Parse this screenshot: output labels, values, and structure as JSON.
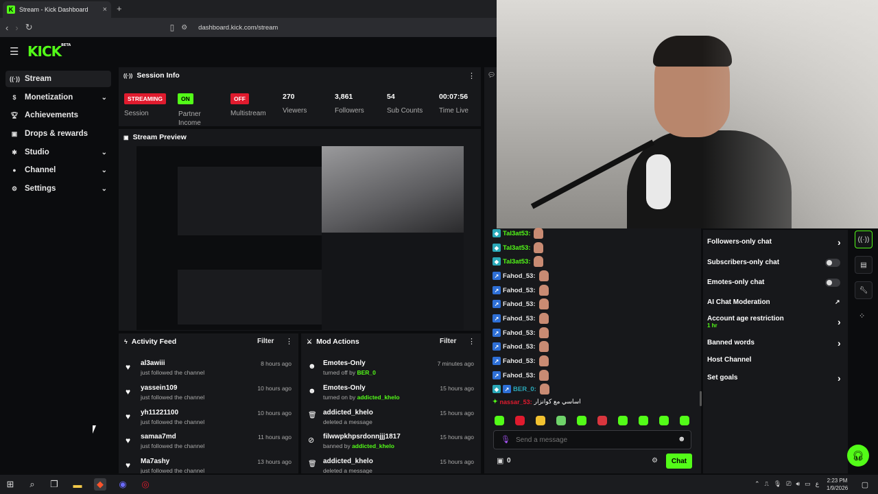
{
  "browser": {
    "tab_title": "Stream - Kick Dashboard",
    "tab_close": "×",
    "new_tab": "+",
    "url": "dashboard.kick.com/stream"
  },
  "app": {
    "logo": "KICK",
    "logo_beta": "BETA"
  },
  "sidebar": {
    "items": [
      {
        "label": "Stream",
        "icon": "broadcast-icon"
      },
      {
        "label": "Monetization",
        "icon": "dollar-icon"
      },
      {
        "label": "Achievements",
        "icon": "trophy-icon"
      },
      {
        "label": "Drops & rewards",
        "icon": "gift-icon"
      },
      {
        "label": "Studio",
        "icon": "studio-icon"
      },
      {
        "label": "Channel",
        "icon": "user-icon"
      },
      {
        "label": "Settings",
        "icon": "gear-icon"
      }
    ]
  },
  "session": {
    "title": "Session Info",
    "stats": [
      {
        "value": "STREAMING",
        "label": "Session"
      },
      {
        "value": "ON",
        "label": "Partner Income"
      },
      {
        "value": "OFF",
        "label": "Multistream"
      },
      {
        "value": "270",
        "label": "Viewers"
      },
      {
        "value": "3,861",
        "label": "Followers"
      },
      {
        "value": "54",
        "label": "Sub Counts"
      },
      {
        "value": "00:07:56",
        "label": "Time Live"
      }
    ]
  },
  "preview": {
    "title": "Stream Preview"
  },
  "activity": {
    "title": "Activity Feed",
    "filter": "Filter",
    "items": [
      {
        "name": "al3awiii",
        "desc": "just followed the channel",
        "time": "8 hours ago"
      },
      {
        "name": "yassein109",
        "desc": "just followed the channel",
        "time": "10 hours ago"
      },
      {
        "name": "yh11221100",
        "desc": "just followed the channel",
        "time": "10 hours ago"
      },
      {
        "name": "samaa7md",
        "desc": "just followed the channel",
        "time": "11 hours ago"
      },
      {
        "name": "Ma7ashy",
        "desc": "just followed the channel",
        "time": "13 hours ago"
      }
    ]
  },
  "mod": {
    "title": "Mod Actions",
    "filter": "Filter",
    "items": [
      {
        "name": "Emotes-Only",
        "desc": "turned off by",
        "user": "BER_0",
        "time": "7 minutes ago"
      },
      {
        "name": "Emotes-Only",
        "desc": "turned on by",
        "user": "addicted_khelo",
        "time": "15 hours ago"
      },
      {
        "name": "addicted_khelo",
        "desc": "deleted a message",
        "user": "",
        "time": "15 hours ago"
      },
      {
        "name": "filwwpkhpsrdonnjjj1817",
        "desc": "banned by",
        "user": "addicted_khelo",
        "time": "15 hours ago"
      },
      {
        "name": "addicted_khelo",
        "desc": "deleted a message",
        "user": "",
        "time": "15 hours ago"
      }
    ]
  },
  "chat": {
    "messages": [
      {
        "user": "Tal3at53:",
        "color": "#53fc18",
        "badge_color": "#2aa8b8"
      },
      {
        "user": "Tal3at53:",
        "color": "#53fc18",
        "badge_color": "#2aa8b8"
      },
      {
        "user": "Tal3at53:",
        "color": "#53fc18",
        "badge_color": "#2aa8b8"
      },
      {
        "user": "Fahod_53:",
        "color": "#ffffff",
        "badge_color": "#2e6fd6"
      },
      {
        "user": "Fahod_53:",
        "color": "#ffffff",
        "badge_color": "#2e6fd6"
      },
      {
        "user": "Fahod_53:",
        "color": "#ffffff",
        "badge_color": "#2e6fd6"
      },
      {
        "user": "Fahod_53:",
        "color": "#ffffff",
        "badge_color": "#2e6fd6"
      },
      {
        "user": "Fahod_53:",
        "color": "#ffffff",
        "badge_color": "#2e6fd6"
      },
      {
        "user": "Fahod_53:",
        "color": "#ffffff",
        "badge_color": "#2e6fd6"
      },
      {
        "user": "Fahod_53:",
        "color": "#ffffff",
        "badge_color": "#2e6fd6"
      },
      {
        "user": "Fahod_53:",
        "color": "#ffffff",
        "badge_color": "#2e6fd6"
      },
      {
        "user": "BER_0:",
        "color": "#2aa8b8",
        "badge_color": "#2aa8b8"
      }
    ],
    "last_user": "nassar_53:",
    "last_text": "اساسي مع كوانزار",
    "placeholder": "Send a message",
    "points": "0",
    "send": "Chat"
  },
  "chat_settings": {
    "items": [
      {
        "label": "Followers-only chat",
        "control": "chevron"
      },
      {
        "label": "Subscribers-only chat",
        "control": "toggle"
      },
      {
        "label": "Emotes-only chat",
        "control": "toggle"
      },
      {
        "label": "AI Chat Moderation",
        "control": "link"
      },
      {
        "label": "Account age restriction",
        "sub": "1 hr",
        "control": "chevron"
      },
      {
        "label": "Banned words",
        "control": "chevron"
      },
      {
        "label": "Host Channel",
        "control": "none"
      },
      {
        "label": "Set goals",
        "control": "chevron"
      }
    ]
  },
  "taskbar": {
    "time": "2:23 PM",
    "date": "1/9/2026",
    "lang": "ع"
  },
  "colors": {
    "accent": "#53fc18",
    "live_red": "#e01b2e"
  }
}
